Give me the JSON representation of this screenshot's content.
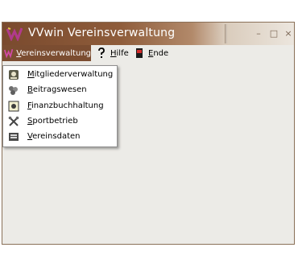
{
  "window": {
    "title": "VVwin Vereinsverwaltung",
    "controls": {
      "minimize": "–",
      "maximize": "□",
      "close": "×"
    }
  },
  "menubar": {
    "items": [
      {
        "key": "V",
        "rest": "ereinsverwaltung",
        "icon": "vvwin-logo-icon"
      },
      {
        "key": "H",
        "rest": "ilfe",
        "icon": "question-icon"
      },
      {
        "key": "E",
        "rest": "nde",
        "icon": "exit-door-icon"
      }
    ]
  },
  "dropdown": {
    "items": [
      {
        "key": "M",
        "rest": "itgliederverwaltung",
        "icon": "members-icon"
      },
      {
        "key": "B",
        "rest": "eitragswesen",
        "icon": "coins-icon"
      },
      {
        "key": "F",
        "rest": "inanzbuchhaltung",
        "icon": "finance-icon"
      },
      {
        "key": "S",
        "rest": "portbetrieb",
        "icon": "sports-icon"
      },
      {
        "key": "V",
        "rest": "ereinsdaten",
        "icon": "club-data-icon"
      }
    ]
  },
  "colors": {
    "title_start": "#7a4a2e",
    "menu_active": "#7b4d31",
    "window_bg": "#ecebe7"
  }
}
